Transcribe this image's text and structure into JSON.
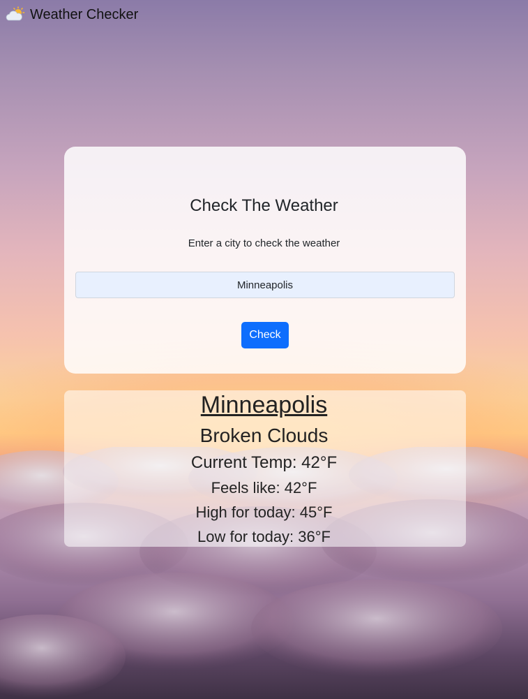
{
  "header": {
    "brand_icon": "cloud-sun-icon",
    "title": "Weather Checker"
  },
  "search": {
    "heading": "Check The Weather",
    "subtitle": "Enter a city to check the weather",
    "city_value": "Minneapolis",
    "button_label": "Check"
  },
  "result": {
    "city": "Minneapolis",
    "description": "Broken Clouds",
    "current_temp": "Current Temp: 42°F",
    "feels_like": "Feels like: 42°F",
    "high": "High for today: 45°F",
    "low": "Low for today: 36°F"
  },
  "colors": {
    "primary_button": "#0d6efd",
    "input_background": "#e8f0fe"
  }
}
